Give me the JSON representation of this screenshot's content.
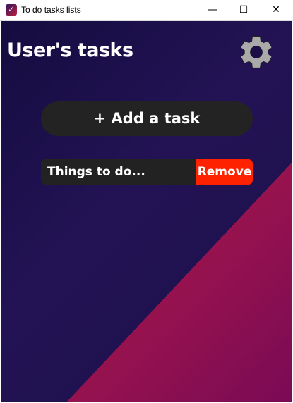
{
  "window": {
    "title": "To do tasks lists",
    "minimize": "—",
    "maximize": "☐",
    "close": "✕"
  },
  "header": {
    "title": "User's tasks",
    "settings_icon": "gear-icon"
  },
  "add_button": {
    "label": "+ Add a task"
  },
  "tasks": [
    {
      "text": "Things to do...",
      "remove_label": "Remove"
    }
  ],
  "colors": {
    "remove": "#ff2200",
    "card": "#222222",
    "background": "#1c0f48",
    "accent": "#b01a48"
  }
}
